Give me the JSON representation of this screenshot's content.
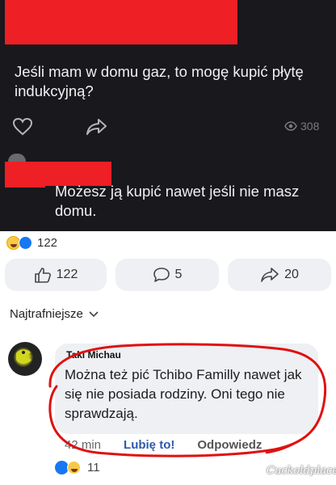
{
  "post": {
    "question": "Jeśli mam w domu gaz, to mogę kupić płytę indukcyjną?",
    "views": "308",
    "icons": {
      "like": "heart-icon",
      "share": "share-arrow-icon",
      "views": "eye-icon"
    }
  },
  "reply": {
    "text": "Możesz ją kupić nawet jeśli nie masz domu."
  },
  "reactions": {
    "count": "122",
    "types": [
      "haha",
      "like"
    ]
  },
  "actions": {
    "likes": "122",
    "comments": "5",
    "shares": "20"
  },
  "sort": {
    "label": "Najtrafniejsze"
  },
  "comment": {
    "author": "Taki Michau",
    "text": "Można też pić Tchibo Familly nawet jak się nie posiada rodziny. Oni tego nie sprawdzają.",
    "time": "42 min",
    "like_label": "Lubię to!",
    "reply_label": "Odpowiedz",
    "reaction_count": "11"
  },
  "watermark": "Cuckoldplace",
  "colors": {
    "dark_bg": "#19181d",
    "redaction": "#ee1f25",
    "pill_bg": "#eef0f3",
    "link_blue": "#2e5aac",
    "marker": "#e01010"
  }
}
